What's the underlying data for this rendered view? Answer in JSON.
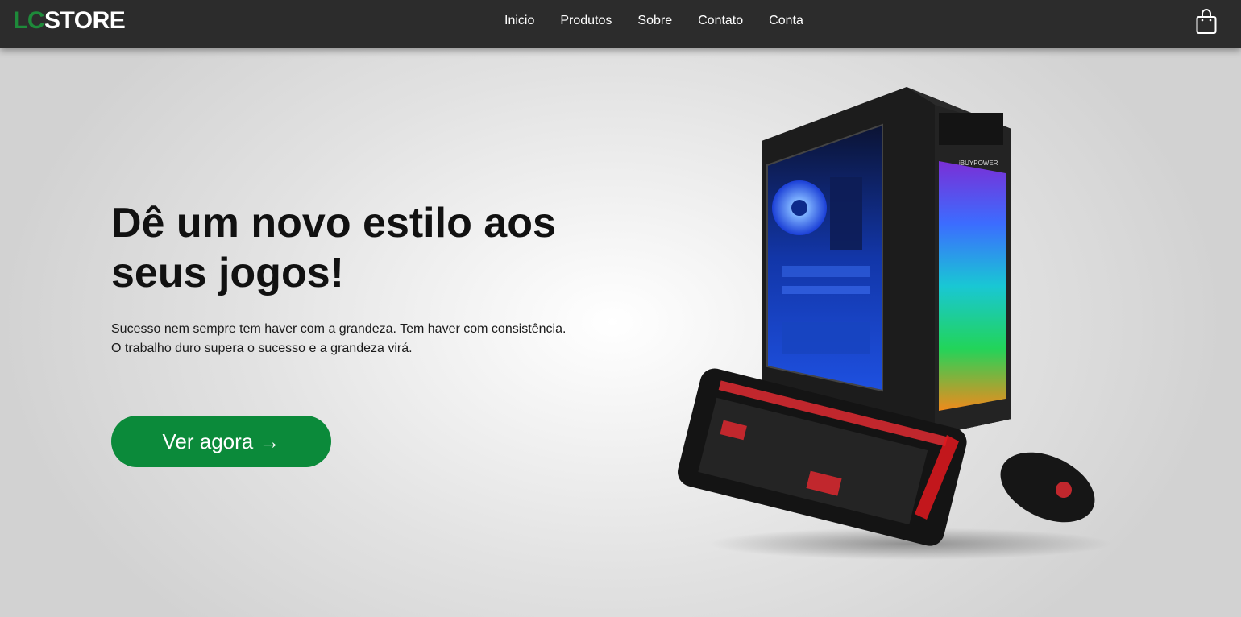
{
  "header": {
    "logo_lc": "LC",
    "logo_store": "STORE",
    "nav": [
      {
        "label": "Inicio"
      },
      {
        "label": "Produtos"
      },
      {
        "label": "Sobre"
      },
      {
        "label": "Contato"
      },
      {
        "label": "Conta"
      }
    ],
    "cart_icon": "shopping-bag-icon"
  },
  "hero": {
    "title": "Dê um novo estilo aos seus jogos!",
    "text": "Sucesso nem sempre tem haver com a grandeza. Tem haver com consistência. O trabalho duro supera o sucesso e a grandeza virá.",
    "button_label": "Ver agora →",
    "image_icon": "gaming-pc-keyboard-mouse-image"
  },
  "colors": {
    "topbar": "#2c2c2c",
    "brand_green": "#0b8a3a",
    "logo_green": "#1e8a3a"
  }
}
